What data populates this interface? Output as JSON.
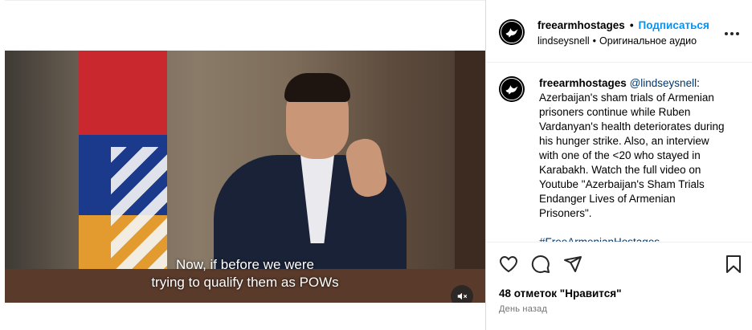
{
  "post": {
    "subtitle_line1": "Now, if before we were",
    "subtitle_line2": "trying to qualify them as POWs"
  },
  "header": {
    "username": "freearmhostages",
    "dot": "•",
    "follow_label": "Подписаться",
    "audio_user": "lindseysnell",
    "audio_sep": "•",
    "audio_label": "Оригинальное аудио"
  },
  "caption": {
    "username": "freearmhostages",
    "mention": "@lindseysnell",
    "text": ": Azerbaijan's sham trials of Armenian prisoners continue while Ruben Vardanyan's health deteriorates during his hunger strike. Also, an interview with one of the <20 who stayed in Karabakh. Watch the full video on Youtube \"Azerbaijan's Sham Trials Endanger Lives of Armenian Prisoners\".",
    "hashtag": "#FreeArmenianHostages"
  },
  "footer": {
    "likes": "48 отметок \"Нравится\"",
    "timestamp": "День назад"
  },
  "icons": {
    "avatar": "dove-logo-icon",
    "more": "more-horizontal-icon",
    "mute": "speaker-muted-icon",
    "like": "heart-icon",
    "comment": "comment-icon",
    "share": "send-icon",
    "save": "bookmark-icon"
  },
  "colors": {
    "accent": "#0095f6",
    "link": "#00376b",
    "muted_text": "#737373"
  }
}
